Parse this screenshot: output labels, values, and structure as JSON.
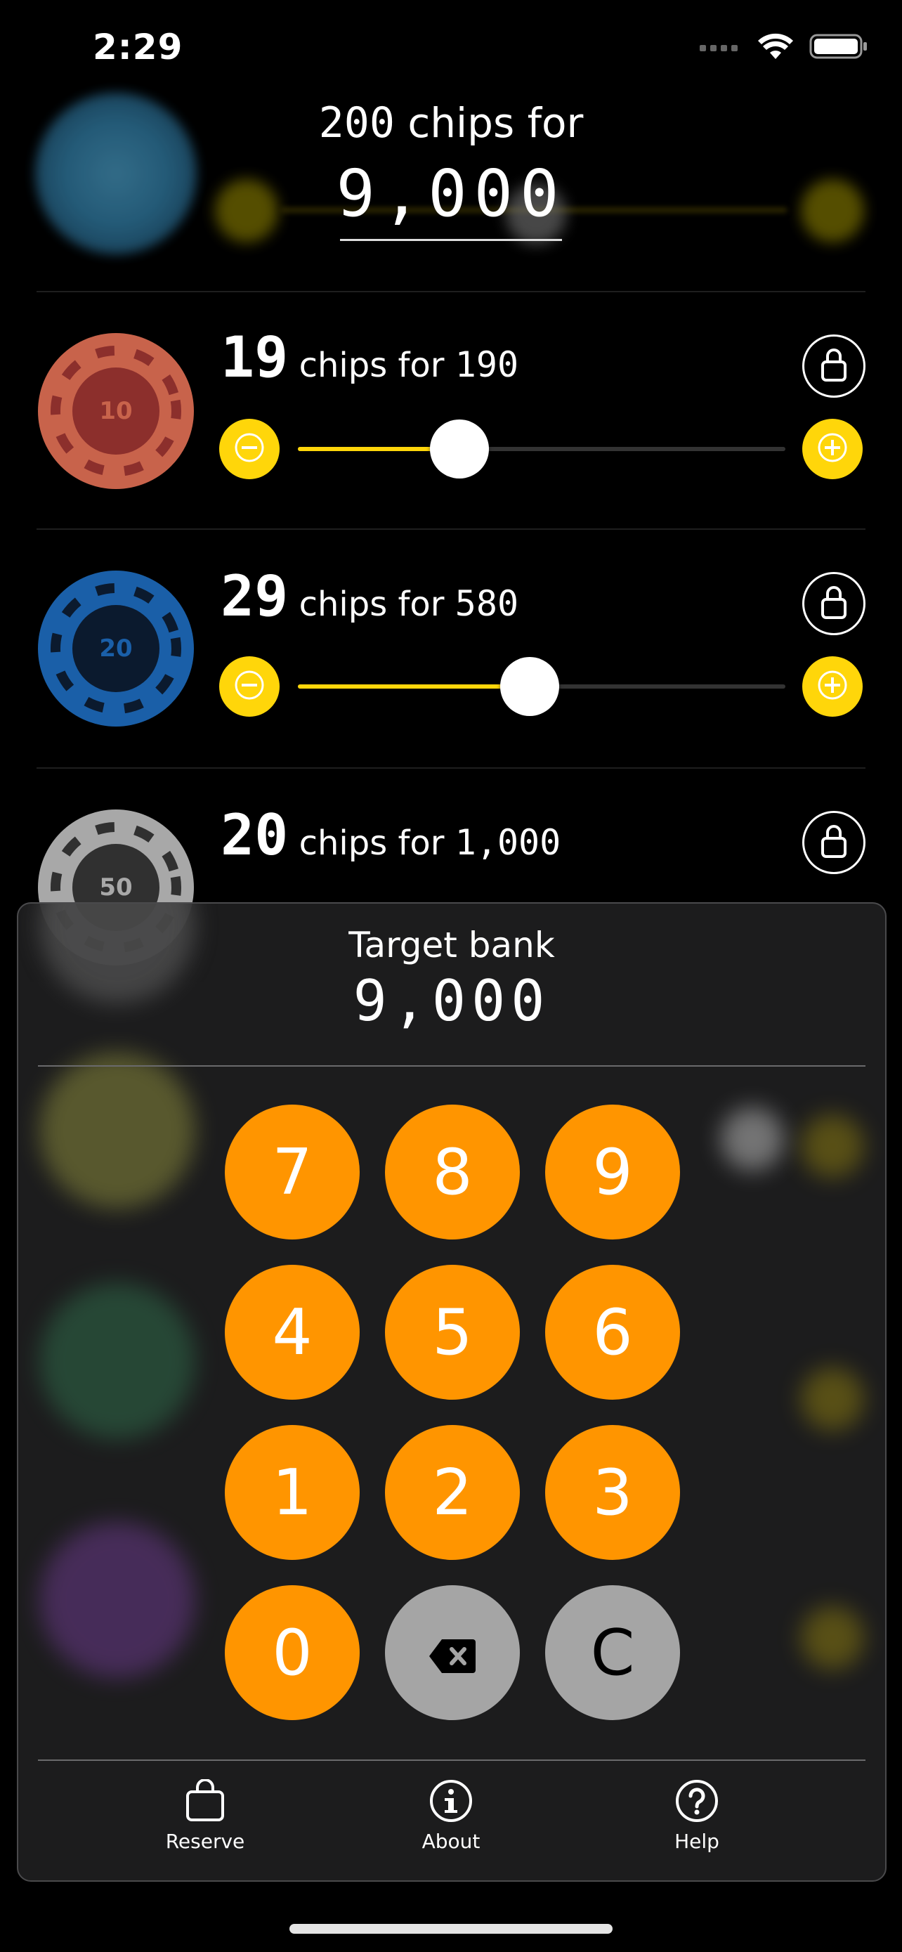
{
  "status_bar": {
    "time": "2:29"
  },
  "summary": {
    "count": "200",
    "chips_for_label": "chips for",
    "total": "9,000"
  },
  "rows": [
    {
      "chip_value": "10",
      "count": "19",
      "chips_for_label": "chips for",
      "price": "190",
      "slider_fraction": 0.33
    },
    {
      "chip_value": "20",
      "count": "29",
      "chips_for_label": "chips for",
      "price": "580",
      "slider_fraction": 0.48
    },
    {
      "chip_value": "50",
      "count": "20",
      "chips_for_label": "chips for",
      "price": "1,000"
    }
  ],
  "keypad": {
    "target_label": "Target bank",
    "target_value": "9,000",
    "keys": [
      "7",
      "8",
      "9",
      "4",
      "5",
      "6",
      "1",
      "2",
      "3",
      "0"
    ],
    "clear_label": "C",
    "delete_icon": "delete-backspace-icon"
  },
  "tabs": [
    {
      "label": "Reserve",
      "icon": "shopping-bag-icon"
    },
    {
      "label": "About",
      "icon": "info-circle-icon"
    },
    {
      "label": "Help",
      "icon": "question-circle-icon"
    }
  ],
  "colors": {
    "accent_yellow": "#ffd60a",
    "keypad_orange": "#ff9500",
    "keypad_gray": "#a5a5a5",
    "chip_10": "#c8634b",
    "chip_20": "#1a5fa8",
    "chip_50": "#a8a8a8"
  }
}
